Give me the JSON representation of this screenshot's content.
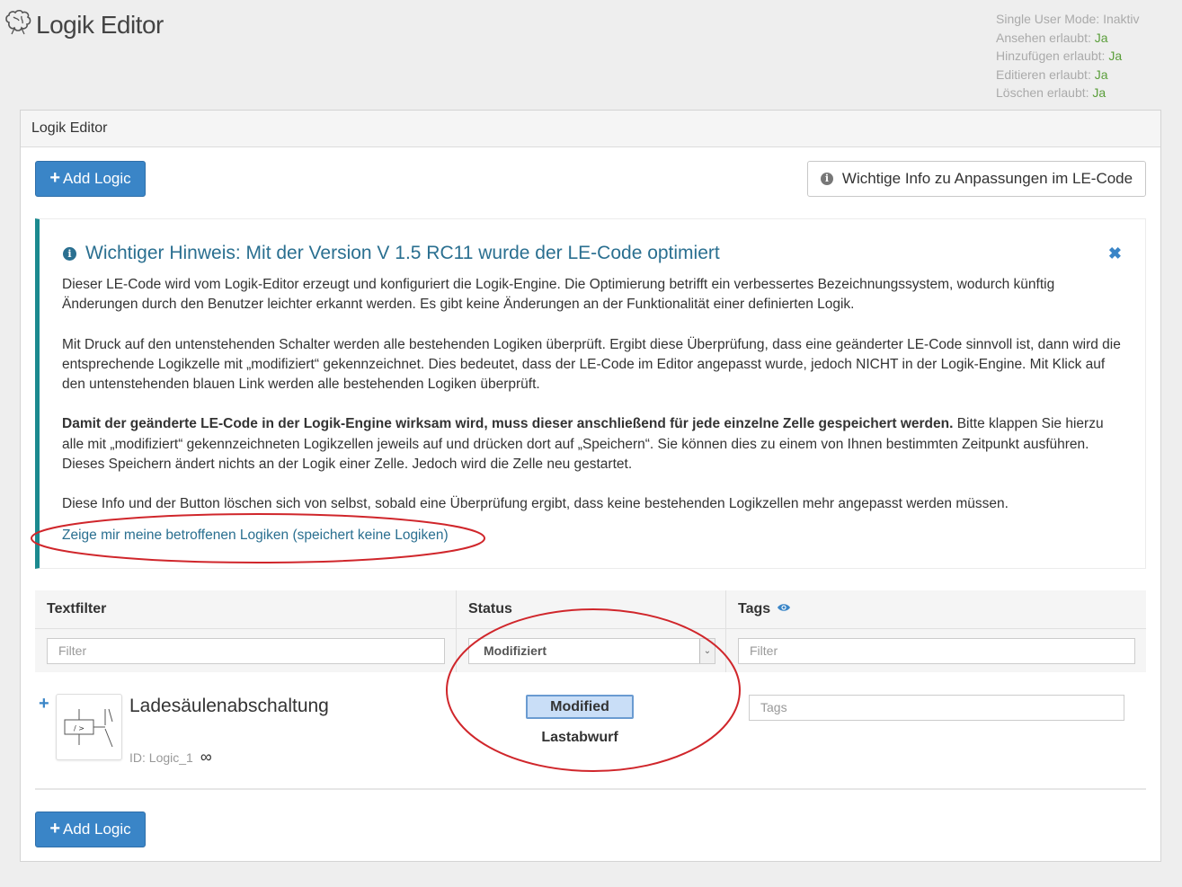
{
  "app": {
    "title": "Logik Editor",
    "logo_icon": "brain-icon"
  },
  "permissions": [
    {
      "label": "Single User Mode:",
      "value": "Inaktiv",
      "value_color": "#aaaaaa"
    },
    {
      "label": "Ansehen erlaubt:",
      "value": "Ja",
      "value_color": "#5a9e3a"
    },
    {
      "label": "Hinzufügen erlaubt:",
      "value": "Ja",
      "value_color": "#5a9e3a"
    },
    {
      "label": "Editieren erlaubt:",
      "value": "Ja",
      "value_color": "#5a9e3a"
    },
    {
      "label": "Löschen erlaubt:",
      "value": "Ja",
      "value_color": "#5a9e3a"
    }
  ],
  "panel": {
    "heading": "Logik Editor",
    "add_logic_label": "Add Logic",
    "info_button_label": "Wichtige Info zu Anpassungen im LE-Code"
  },
  "notice": {
    "title": "Wichtiger Hinweis: Mit der Version V 1.5 RC11 wurde der LE-Code optimiert",
    "close_icon": "close-icon",
    "para1": "Dieser LE-Code wird vom Logik-Editor erzeugt und konfiguriert die Logik-Engine. Die Optimierung betrifft ein verbessertes Bezeichnungssystem, wodurch künftig Änderungen durch den Benutzer leichter erkannt werden. Es gibt keine Änderungen an der Funktionalität einer definierten Logik.",
    "para2": "Mit Druck auf den untenstehenden Schalter werden alle bestehenden Logiken überprüft. Ergibt diese Überprüfung, dass eine geänderter LE-Code sinnvoll ist, dann wird die entsprechende Logikzelle mit „modifiziert“ gekennzeichnet. Dies bedeutet, dass der LE-Code im Editor angepasst wurde, jedoch NICHT in der Logik-Engine. Mit Klick auf den untenstehenden blauen Link werden alle bestehenden Logiken überprüft.",
    "para3_bold": "Damit der geänderte LE-Code in der Logik-Engine wirksam wird, muss dieser anschließend für jede einzelne Zelle gespeichert werden.",
    "para3_rest": " Bitte klappen Sie hierzu alle mit „modifiziert“ gekennzeichneten Logikzellen jeweils auf und drücken dort auf „Speichern“. Sie können dies zu einem von Ihnen bestimmten Zeitpunkt ausführen. Dieses Speichern ändert nichts an der Logik einer Zelle. Jedoch wird die Zelle neu gestartet.",
    "para4": "Diese Info und der Button löschen sich von selbst, sobald eine Überprüfung ergibt, dass keine bestehenden Logikzellen mehr angepasst werden müssen.",
    "link": "Zeige mir meine betroffenen Logiken (speichert keine Logiken)"
  },
  "filters": {
    "text": {
      "header": "Textfilter",
      "placeholder": "Filter"
    },
    "status": {
      "header": "Status",
      "selected": "Modifiziert"
    },
    "tags": {
      "header": "Tags",
      "placeholder": "Filter",
      "icon": "eye-icon"
    }
  },
  "logics": [
    {
      "name": "Ladesäulenabschaltung",
      "id_text": "ID: Logic_1",
      "id_symbol": "∞",
      "status_badge": "Modified",
      "status_text": "Lastabwurf",
      "tags_placeholder": "Tags",
      "thumb_label": "/ >"
    }
  ],
  "colors": {
    "primary": "#3a85c7",
    "notice_accent": "#1b8a8f",
    "annotation": "#d0262b"
  }
}
